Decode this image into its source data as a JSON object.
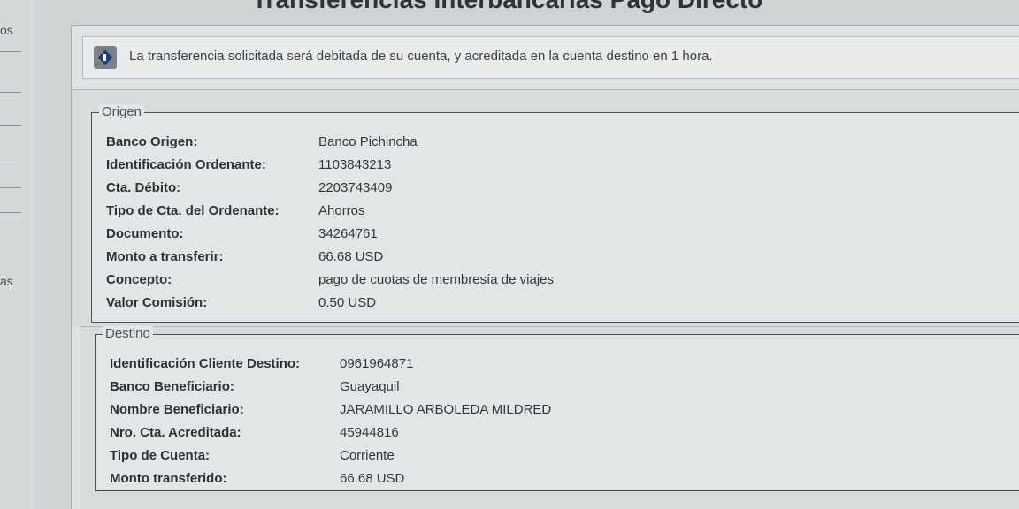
{
  "left_nav": {
    "item_top": "os",
    "item_mid": "as"
  },
  "heading": {
    "title": "Transferencias Interbancarias Pago Directo"
  },
  "notice": {
    "icon": "info-icon",
    "text": "La transferencia solicitada será debitada de su cuenta, y acreditada en la cuenta destino en 1 hora."
  },
  "origen": {
    "legend": "Origen",
    "rows": [
      {
        "label": "Banco Origen:",
        "value": "Banco Pichincha"
      },
      {
        "label": "Identificación Ordenante:",
        "value": "1103843213"
      },
      {
        "label": "Cta. Débito:",
        "value": "2203743409"
      },
      {
        "label": "Tipo de Cta. del Ordenante:",
        "value": "Ahorros"
      },
      {
        "label": "Documento:",
        "value": "34264761"
      },
      {
        "label": "Monto a transferir:",
        "value": "66.68 USD"
      },
      {
        "label": "Concepto:",
        "value": "pago de cuotas de membresía de viajes"
      },
      {
        "label": "Valor Comisión:",
        "value": "0.50 USD"
      }
    ]
  },
  "destino": {
    "legend": "Destino",
    "rows": [
      {
        "label": "Identificación Cliente Destino:",
        "value": "0961964871"
      },
      {
        "label": "Banco Beneficiario:",
        "value": "Guayaquil"
      },
      {
        "label": "Nombre Beneficiario:",
        "value": "JARAMILLO ARBOLEDA MILDRED"
      },
      {
        "label": "Nro. Cta. Acreditada:",
        "value": "45944816"
      },
      {
        "label": "Tipo de Cuenta:",
        "value": "Corriente"
      },
      {
        "label": "Monto transferido:",
        "value": "66.68 USD"
      }
    ]
  }
}
